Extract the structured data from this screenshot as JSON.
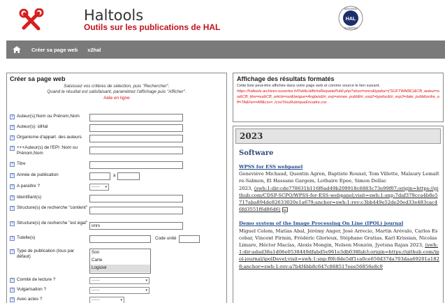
{
  "header": {
    "title": "Haltools",
    "subtitle": "Outils sur les publications de HAL",
    "badge_top": "ARCHIVES",
    "badge_center": "HAL",
    "badge_bottom": "OUVERTES",
    "logo_icon": "tools-icon"
  },
  "nav": {
    "home_icon": "home-icon",
    "items": [
      "Créer sa page web",
      "x2hal"
    ]
  },
  "form": {
    "title": "Créer sa page web",
    "intro_line1": "Saisissez vos critères de sélection, puis \"Rechercher\".",
    "intro_line2": "Quand le résultat est satisfaisant, paramétrez l'affichage puis \"Afficher\".",
    "help_link": "Aide en ligne",
    "fields": {
      "author_name": "Auteur(s):Nom ou Prénom,Nom",
      "author_idhal": "Auteur(s): idHal",
      "organisme": "Organisme d'appart. des auteurs",
      "epi_author": "+++Auteur(s) de l'EPI :Nom ou Prénom,Nom",
      "titre": "Titre",
      "annee": "Année de publication",
      "annee_sep": "à",
      "a_paraitre": "A paraître ?",
      "a_paraitre_value": "------",
      "identifiants": "Identifiant(s)",
      "structure_contient": "Structure(s) de recherche \"contient\"",
      "structure_egal": "Structure(s) de recherche \"est égal\"",
      "structure_egal_value": "onrs",
      "tutelles": "Tutelle(s)",
      "code_unite": "Code unité",
      "type_pub": "Type de publication (tous par défaut)",
      "type_options": [
        "Son",
        "Carte",
        "Logiciel"
      ],
      "type_selected": "Logiciel",
      "comite": "Comité de lecture ?",
      "comite_value": "------",
      "vulgarisation": "Vulgarisation ?",
      "vulgarisation_value": "------",
      "actes": "Avec actes ?",
      "actes_value": "------"
    }
  },
  "results_info": {
    "title": "Affichage des résultats formatés",
    "desc": "Cette liste peut-être affichée dans votre page web et comme source le lien suivant.",
    "url": "https://haltools.archives-ouvertes.fr/Public/afficheRequetePubli.php?struct=onrs&typdoc=('SOFTWARE')&CB_auteur=oui&CB_titre=oui&CB_article=oui&langue=Anglais&tri_exp=annee_publi&tri_exp2=typdoc&tri_exp3=date_publi&ordre_aff=TA&Fen=Aff&css=../css/VisuRubriqueEncadre.css"
  },
  "results": {
    "year": "2023",
    "section": "Software",
    "publications": [
      {
        "title": "WPSS for ESS webpanel",
        "authors": "Geneviève Michaud, Quentin Agren, Baptiste Rouxel, Tom Villette, Malaury Lemaître-Salmon, El Hassane Gargem, Lothaire Epee, Simon Dellac",
        "year": "2023,",
        "swh": "⟨swh:1:dir:cde778631b116f6ad49b209918c6883c73e99f07;origin=https://github.com/CDSP-SCPO/WPSS-for-ESS-webpanel;visit=swh:1:snp:7daf379cca4b8e5717aba894de82633020e1a679;anchor=swh:1:rev:c3bb449e52de20ed33e483cac46fd3551f6d86d6⟩",
        "hal_mini": "hal"
      },
      {
        "title": "Demo system of the Image Processing On Line (IPOL) journal",
        "authors": "Miguel Colom, Matías Abal, Jérémy Anger, José Arrecio, Martin Arévalo, Carlos Escobar, Vincent Firmin, Frédéric Glorieux, Stéphane Gratias, Karl Krissian, Nicolas Limare, Héctor Macías, Alexis Mongin, Nelson Monzón, Jyotsna Rajan",
        "year": "2023,",
        "swh": "⟨swh:1:dir:adad38a1d06e0538449dfabd5e961e3db038fab3;origin=https://github.com/ipol-journal/ipolDevel;visit=swh:1:snp:f0fc8de5df1ca0ce650d37da703daa69201a1828;anchor=swh:1:rev:a7b4f4bb8c647c868517eee56856e8c9"
      }
    ]
  }
}
